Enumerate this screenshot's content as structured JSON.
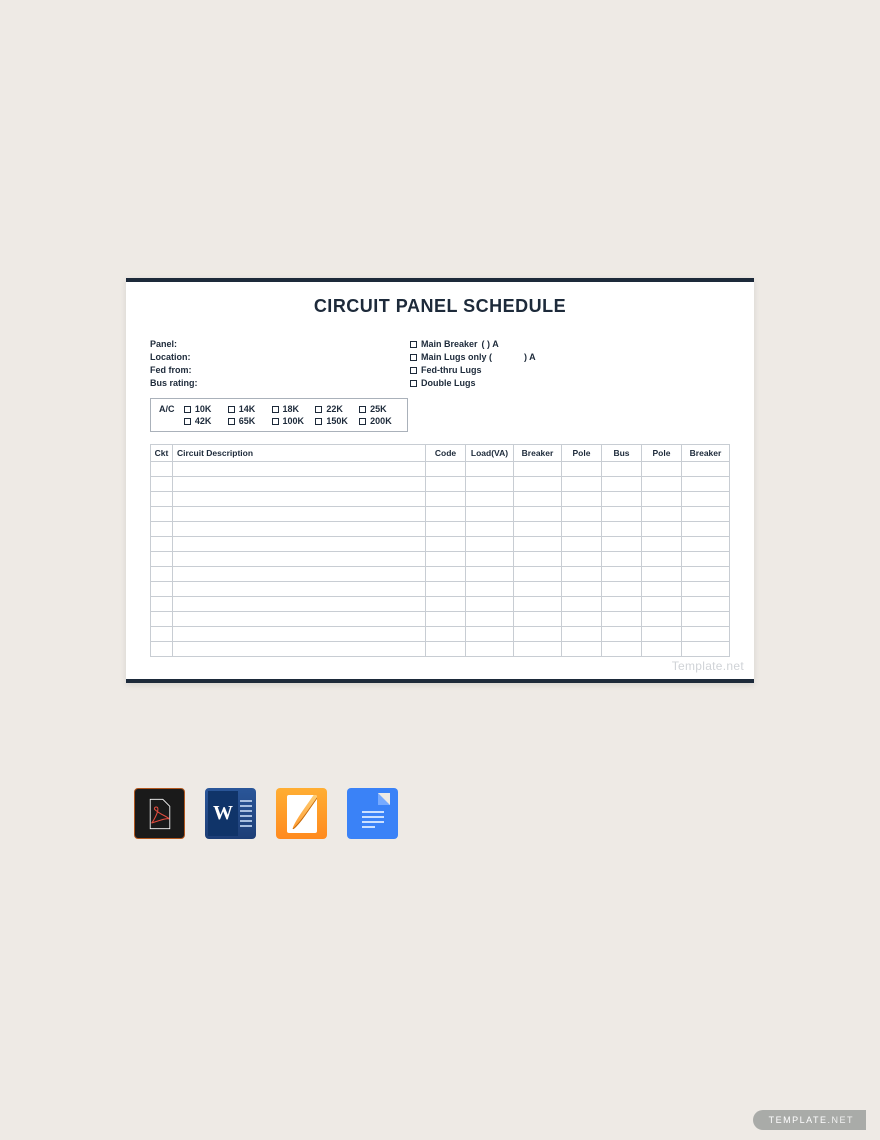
{
  "title": "CIRCUIT PANEL SCHEDULE",
  "info_left": {
    "panel": "Panel:",
    "location": "Location:",
    "fed_from": "Fed from:",
    "bus_rating": "Bus rating:"
  },
  "info_right": {
    "main_breaker": "Main Breaker",
    "main_breaker_paren": "(            ) A",
    "main_lugs": "Main Lugs only (",
    "main_lugs_end": ") A",
    "fed_thru": "Fed-thru Lugs",
    "double_lugs": "Double Lugs"
  },
  "ac": {
    "label": "A/C",
    "row1": [
      "10K",
      "14K",
      "18K",
      "22K",
      "25K"
    ],
    "row2": [
      "42K",
      "65K",
      "100K",
      "150K",
      "200K"
    ]
  },
  "columns": {
    "ckt": "Ckt",
    "desc": "Circuit Description",
    "code": "Code",
    "load": "Load(VA)",
    "breaker": "Breaker",
    "pole": "Pole",
    "bus": "Bus",
    "pole2": "Pole",
    "breaker2": "Breaker"
  },
  "row_count": 13,
  "watermark": "Template.net",
  "footer": {
    "brand": "TEMPLATE",
    "suffix": ".NET"
  }
}
